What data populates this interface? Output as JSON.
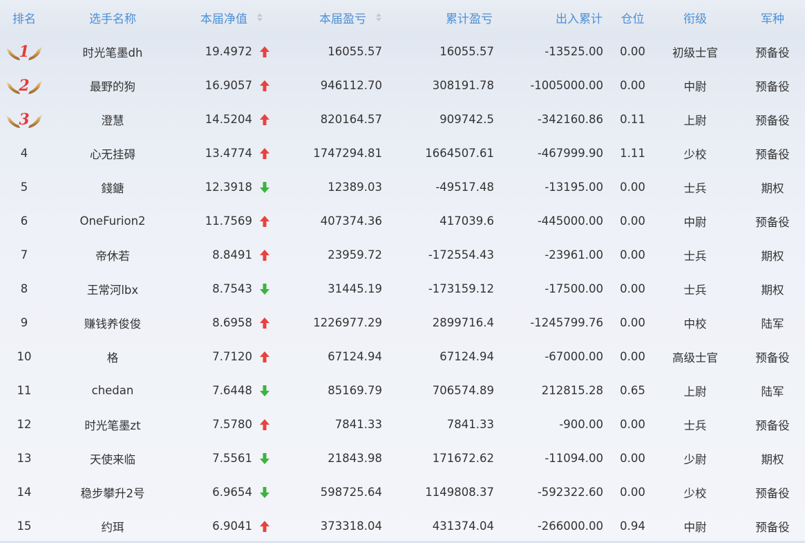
{
  "headers": {
    "rank": "排名",
    "name": "选手名称",
    "nav": "本届净值",
    "round_pl": "本届盈亏",
    "cum_pl": "累计盈亏",
    "io_total": "出入累计",
    "position": "仓位",
    "title": "衔级",
    "service": "军种"
  },
  "colors": {
    "header_text": "#4d90d6",
    "up_arrow": "#e8423f",
    "down_arrow": "#3cb33c",
    "rank_badge": "#e23b3b"
  },
  "rows": [
    {
      "rank": "1",
      "medal": true,
      "name": "时光笔墨dh",
      "nav": "19.4972",
      "trend": "up",
      "round_pl": "16055.57",
      "cum_pl": "16055.57",
      "io_total": "-13525.00",
      "position": "0.00",
      "title": "初级士官",
      "service": "预备役"
    },
    {
      "rank": "2",
      "medal": true,
      "name": "最野的狗",
      "nav": "16.9057",
      "trend": "up",
      "round_pl": "946112.70",
      "cum_pl": "308191.78",
      "io_total": "-1005000.00",
      "position": "0.00",
      "title": "中尉",
      "service": "预备役"
    },
    {
      "rank": "3",
      "medal": true,
      "name": "澄慧",
      "nav": "14.5204",
      "trend": "up",
      "round_pl": "820164.57",
      "cum_pl": "909742.5",
      "io_total": "-342160.86",
      "position": "0.11",
      "title": "上尉",
      "service": "预备役"
    },
    {
      "rank": "4",
      "medal": false,
      "name": "心无挂碍",
      "nav": "13.4774",
      "trend": "up",
      "round_pl": "1747294.81",
      "cum_pl": "1664507.61",
      "io_total": "-467999.90",
      "position": "1.11",
      "title": "少校",
      "service": "预备役"
    },
    {
      "rank": "5",
      "medal": false,
      "name": "錢鎕",
      "nav": "12.3918",
      "trend": "down",
      "round_pl": "12389.03",
      "cum_pl": "-49517.48",
      "io_total": "-13195.00",
      "position": "0.00",
      "title": "士兵",
      "service": "期权"
    },
    {
      "rank": "6",
      "medal": false,
      "name": "OneFurion2",
      "nav": "11.7569",
      "trend": "up",
      "round_pl": "407374.36",
      "cum_pl": "417039.6",
      "io_total": "-445000.00",
      "position": "0.00",
      "title": "中尉",
      "service": "预备役"
    },
    {
      "rank": "7",
      "medal": false,
      "name": "帝休若",
      "nav": "8.8491",
      "trend": "up",
      "round_pl": "23959.72",
      "cum_pl": "-172554.43",
      "io_total": "-23961.00",
      "position": "0.00",
      "title": "士兵",
      "service": "期权"
    },
    {
      "rank": "8",
      "medal": false,
      "name": "王常河lbx",
      "nav": "8.7543",
      "trend": "down",
      "round_pl": "31445.19",
      "cum_pl": "-173159.12",
      "io_total": "-17500.00",
      "position": "0.00",
      "title": "士兵",
      "service": "期权"
    },
    {
      "rank": "9",
      "medal": false,
      "name": "赚钱养俊俊",
      "nav": "8.6958",
      "trend": "up",
      "round_pl": "1226977.29",
      "cum_pl": "2899716.4",
      "io_total": "-1245799.76",
      "position": "0.00",
      "title": "中校",
      "service": "陆军"
    },
    {
      "rank": "10",
      "medal": false,
      "name": "格",
      "nav": "7.7120",
      "trend": "up",
      "round_pl": "67124.94",
      "cum_pl": "67124.94",
      "io_total": "-67000.00",
      "position": "0.00",
      "title": "高级士官",
      "service": "预备役"
    },
    {
      "rank": "11",
      "medal": false,
      "name": "chedan",
      "nav": "7.6448",
      "trend": "down",
      "round_pl": "85169.79",
      "cum_pl": "706574.89",
      "io_total": "212815.28",
      "position": "0.65",
      "title": "上尉",
      "service": "陆军"
    },
    {
      "rank": "12",
      "medal": false,
      "name": "时光笔墨zt",
      "nav": "7.5780",
      "trend": "up",
      "round_pl": "7841.33",
      "cum_pl": "7841.33",
      "io_total": "-900.00",
      "position": "0.00",
      "title": "士兵",
      "service": "预备役"
    },
    {
      "rank": "13",
      "medal": false,
      "name": "天使来临",
      "nav": "7.5561",
      "trend": "down",
      "round_pl": "21843.98",
      "cum_pl": "171672.62",
      "io_total": "-11094.00",
      "position": "0.00",
      "title": "少尉",
      "service": "期权"
    },
    {
      "rank": "14",
      "medal": false,
      "name": "稳步攀升2号",
      "nav": "6.9654",
      "trend": "down",
      "round_pl": "598725.64",
      "cum_pl": "1149808.37",
      "io_total": "-592322.60",
      "position": "0.00",
      "title": "少校",
      "service": "预备役"
    },
    {
      "rank": "15",
      "medal": false,
      "name": "约珥",
      "nav": "6.9041",
      "trend": "up",
      "round_pl": "373318.04",
      "cum_pl": "431374.04",
      "io_total": "-266000.00",
      "position": "0.94",
      "title": "中尉",
      "service": "预备役"
    }
  ]
}
